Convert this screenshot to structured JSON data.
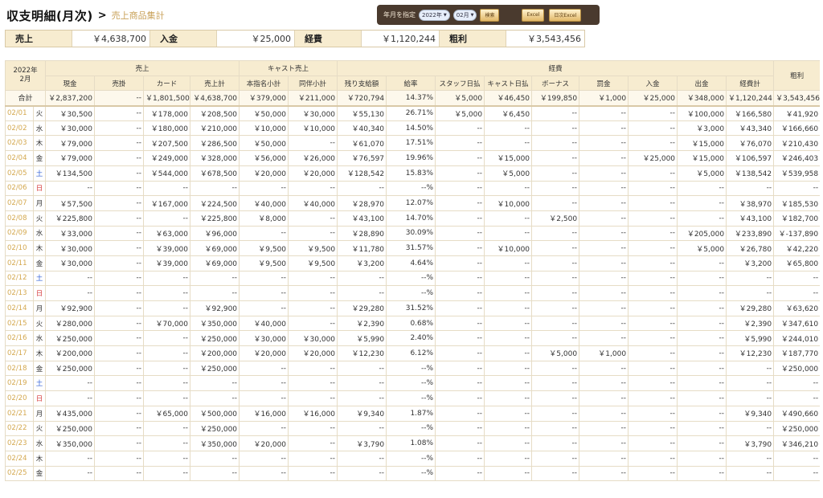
{
  "header": {
    "title": "収支明細(月次)",
    "separator": ">",
    "breadcrumb": "売上商品集計"
  },
  "toolbar": {
    "label": "年月を指定",
    "year": "2022年",
    "month": "02月",
    "search": "検索",
    "excel": "Excel",
    "daily_excel": "日次Excel"
  },
  "summary": [
    {
      "label": "売上",
      "value": "￥4,638,700"
    },
    {
      "label": "入金",
      "value": "￥25,000"
    },
    {
      "label": "経費",
      "value": "￥1,120,244"
    },
    {
      "label": "粗利",
      "value": "￥3,543,456"
    }
  ],
  "table": {
    "corner": {
      "year": "2022年",
      "month": "2月"
    },
    "groups": {
      "sales": "売上",
      "cast_sales": "キャスト売上",
      "expenses": "経費",
      "gross": "粗利"
    },
    "columns": [
      "現金",
      "売掛",
      "カード",
      "売上計",
      "本指名小計",
      "同伴小計",
      "残り支給額",
      "給率",
      "スタッフ日払",
      "キャスト日払",
      "ボーナス",
      "罰金",
      "入金",
      "出金",
      "経費計"
    ],
    "total": {
      "label": "合計",
      "cells": [
        "￥2,837,200",
        "--",
        "￥1,801,500",
        "￥4,638,700",
        "￥379,000",
        "￥211,000",
        "￥720,794",
        "14.37%",
        "￥5,000",
        "￥46,450",
        "￥199,850",
        "￥1,000",
        "￥25,000",
        "￥348,000",
        "￥1,120,244",
        "￥3,543,456"
      ]
    },
    "rows": [
      {
        "date": "02/01",
        "wd": "火",
        "cells": [
          "￥30,500",
          "--",
          "￥178,000",
          "￥208,500",
          "￥50,000",
          "￥30,000",
          "￥55,130",
          "26.71%",
          "￥5,000",
          "￥6,450",
          "--",
          "--",
          "--",
          "￥100,000",
          "￥166,580",
          "￥41,920"
        ]
      },
      {
        "date": "02/02",
        "wd": "水",
        "cells": [
          "￥30,000",
          "--",
          "￥180,000",
          "￥210,000",
          "￥10,000",
          "￥10,000",
          "￥40,340",
          "14.50%",
          "--",
          "--",
          "--",
          "--",
          "--",
          "￥3,000",
          "￥43,340",
          "￥166,660"
        ]
      },
      {
        "date": "02/03",
        "wd": "木",
        "cells": [
          "￥79,000",
          "--",
          "￥207,500",
          "￥286,500",
          "￥50,000",
          "--",
          "￥61,070",
          "17.51%",
          "--",
          "--",
          "--",
          "--",
          "--",
          "￥15,000",
          "￥76,070",
          "￥210,430"
        ]
      },
      {
        "date": "02/04",
        "wd": "金",
        "cells": [
          "￥79,000",
          "--",
          "￥249,000",
          "￥328,000",
          "￥56,000",
          "￥26,000",
          "￥76,597",
          "19.96%",
          "--",
          "￥15,000",
          "--",
          "--",
          "￥25,000",
          "￥15,000",
          "￥106,597",
          "￥246,403"
        ]
      },
      {
        "date": "02/05",
        "wd": "土",
        "cells": [
          "￥134,500",
          "--",
          "￥544,000",
          "￥678,500",
          "￥20,000",
          "￥20,000",
          "￥128,542",
          "15.83%",
          "--",
          "￥5,000",
          "--",
          "--",
          "--",
          "￥5,000",
          "￥138,542",
          "￥539,958"
        ]
      },
      {
        "date": "02/06",
        "wd": "日",
        "cells": [
          "--",
          "--",
          "--",
          "--",
          "--",
          "--",
          "--",
          "--%",
          "--",
          "--",
          "--",
          "--",
          "--",
          "--",
          "--",
          "--"
        ]
      },
      {
        "date": "02/07",
        "wd": "月",
        "cells": [
          "￥57,500",
          "--",
          "￥167,000",
          "￥224,500",
          "￥40,000",
          "￥40,000",
          "￥28,970",
          "12.07%",
          "--",
          "￥10,000",
          "--",
          "--",
          "--",
          "--",
          "￥38,970",
          "￥185,530"
        ]
      },
      {
        "date": "02/08",
        "wd": "火",
        "cells": [
          "￥225,800",
          "--",
          "--",
          "￥225,800",
          "￥8,000",
          "--",
          "￥43,100",
          "14.70%",
          "--",
          "--",
          "￥2,500",
          "--",
          "--",
          "--",
          "￥43,100",
          "￥182,700"
        ]
      },
      {
        "date": "02/09",
        "wd": "水",
        "cells": [
          "￥33,000",
          "--",
          "￥63,000",
          "￥96,000",
          "--",
          "--",
          "￥28,890",
          "30.09%",
          "--",
          "--",
          "--",
          "--",
          "--",
          "￥205,000",
          "￥233,890",
          "￥-137,890"
        ]
      },
      {
        "date": "02/10",
        "wd": "木",
        "cells": [
          "￥30,000",
          "--",
          "￥39,000",
          "￥69,000",
          "￥9,500",
          "￥9,500",
          "￥11,780",
          "31.57%",
          "--",
          "￥10,000",
          "--",
          "--",
          "--",
          "￥5,000",
          "￥26,780",
          "￥42,220"
        ]
      },
      {
        "date": "02/11",
        "wd": "金",
        "cells": [
          "￥30,000",
          "--",
          "￥39,000",
          "￥69,000",
          "￥9,500",
          "￥9,500",
          "￥3,200",
          "4.64%",
          "--",
          "--",
          "--",
          "--",
          "--",
          "--",
          "￥3,200",
          "￥65,800"
        ]
      },
      {
        "date": "02/12",
        "wd": "土",
        "cells": [
          "--",
          "--",
          "--",
          "--",
          "--",
          "--",
          "--",
          "--%",
          "--",
          "--",
          "--",
          "--",
          "--",
          "--",
          "--",
          "--"
        ]
      },
      {
        "date": "02/13",
        "wd": "日",
        "cells": [
          "--",
          "--",
          "--",
          "--",
          "--",
          "--",
          "--",
          "--%",
          "--",
          "--",
          "--",
          "--",
          "--",
          "--",
          "--",
          "--"
        ]
      },
      {
        "date": "02/14",
        "wd": "月",
        "cells": [
          "￥92,900",
          "--",
          "--",
          "￥92,900",
          "--",
          "--",
          "￥29,280",
          "31.52%",
          "--",
          "--",
          "--",
          "--",
          "--",
          "--",
          "￥29,280",
          "￥63,620"
        ]
      },
      {
        "date": "02/15",
        "wd": "火",
        "cells": [
          "￥280,000",
          "--",
          "￥70,000",
          "￥350,000",
          "￥40,000",
          "--",
          "￥2,390",
          "0.68%",
          "--",
          "--",
          "--",
          "--",
          "--",
          "--",
          "￥2,390",
          "￥347,610"
        ]
      },
      {
        "date": "02/16",
        "wd": "水",
        "cells": [
          "￥250,000",
          "--",
          "--",
          "￥250,000",
          "￥30,000",
          "￥30,000",
          "￥5,990",
          "2.40%",
          "--",
          "--",
          "--",
          "--",
          "--",
          "--",
          "￥5,990",
          "￥244,010"
        ]
      },
      {
        "date": "02/17",
        "wd": "木",
        "cells": [
          "￥200,000",
          "--",
          "--",
          "￥200,000",
          "￥20,000",
          "￥20,000",
          "￥12,230",
          "6.12%",
          "--",
          "--",
          "￥5,000",
          "￥1,000",
          "--",
          "--",
          "￥12,230",
          "￥187,770"
        ]
      },
      {
        "date": "02/18",
        "wd": "金",
        "cells": [
          "￥250,000",
          "--",
          "--",
          "￥250,000",
          "--",
          "--",
          "--",
          "--%",
          "--",
          "--",
          "--",
          "--",
          "--",
          "--",
          "--",
          "￥250,000"
        ]
      },
      {
        "date": "02/19",
        "wd": "土",
        "cells": [
          "--",
          "--",
          "--",
          "--",
          "--",
          "--",
          "--",
          "--%",
          "--",
          "--",
          "--",
          "--",
          "--",
          "--",
          "--",
          "--"
        ]
      },
      {
        "date": "02/20",
        "wd": "日",
        "cells": [
          "--",
          "--",
          "--",
          "--",
          "--",
          "--",
          "--",
          "--%",
          "--",
          "--",
          "--",
          "--",
          "--",
          "--",
          "--",
          "--"
        ]
      },
      {
        "date": "02/21",
        "wd": "月",
        "cells": [
          "￥435,000",
          "--",
          "￥65,000",
          "￥500,000",
          "￥16,000",
          "￥16,000",
          "￥9,340",
          "1.87%",
          "--",
          "--",
          "--",
          "--",
          "--",
          "--",
          "￥9,340",
          "￥490,660"
        ]
      },
      {
        "date": "02/22",
        "wd": "火",
        "cells": [
          "￥250,000",
          "--",
          "--",
          "￥250,000",
          "--",
          "--",
          "--",
          "--%",
          "--",
          "--",
          "--",
          "--",
          "--",
          "--",
          "--",
          "￥250,000"
        ]
      },
      {
        "date": "02/23",
        "wd": "水",
        "cells": [
          "￥350,000",
          "--",
          "--",
          "￥350,000",
          "￥20,000",
          "--",
          "￥3,790",
          "1.08%",
          "--",
          "--",
          "--",
          "--",
          "--",
          "--",
          "￥3,790",
          "￥346,210"
        ]
      },
      {
        "date": "02/24",
        "wd": "木",
        "cells": [
          "--",
          "--",
          "--",
          "--",
          "--",
          "--",
          "--",
          "--%",
          "--",
          "--",
          "--",
          "--",
          "--",
          "--",
          "--",
          "--"
        ]
      },
      {
        "date": "02/25",
        "wd": "金",
        "cells": [
          "--",
          "--",
          "--",
          "--",
          "--",
          "--",
          "--",
          "--%",
          "--",
          "--",
          "--",
          "--",
          "--",
          "--",
          "--",
          "--"
        ]
      }
    ]
  },
  "colors": {
    "accent": "#c9a25a",
    "header_bg": "#f7ecd0",
    "toolbar_bg": "#4a3a2e",
    "saturday": "#2f5fd6",
    "sunday": "#d63b3b"
  }
}
